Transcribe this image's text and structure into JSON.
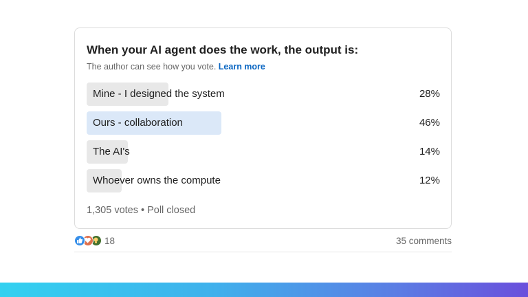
{
  "poll": {
    "question": "When your AI agent does the work, the output is:",
    "privacy_text": "The author can see how you vote.",
    "learn_more": "Learn more",
    "options": [
      {
        "label": "Mine - I designed the system",
        "percent_text": "28%",
        "percent": 28,
        "selected": false
      },
      {
        "label": "Ours - collaboration",
        "percent_text": "46%",
        "percent": 46,
        "selected": true
      },
      {
        "label": "The AI's",
        "percent_text": "14%",
        "percent": 14,
        "selected": false
      },
      {
        "label": "Whoever owns the compute",
        "percent_text": "12%",
        "percent": 12,
        "selected": false
      }
    ],
    "status": "1,305 votes • Poll closed"
  },
  "social": {
    "reactions": [
      "like-icon",
      "love-icon",
      "insightful-icon"
    ],
    "reaction_count": "18",
    "comments": "35 comments"
  },
  "colors": {
    "selected_bar": "#dbe8f8",
    "default_bar": "#e8e8e8",
    "link": "#0a66c2"
  }
}
